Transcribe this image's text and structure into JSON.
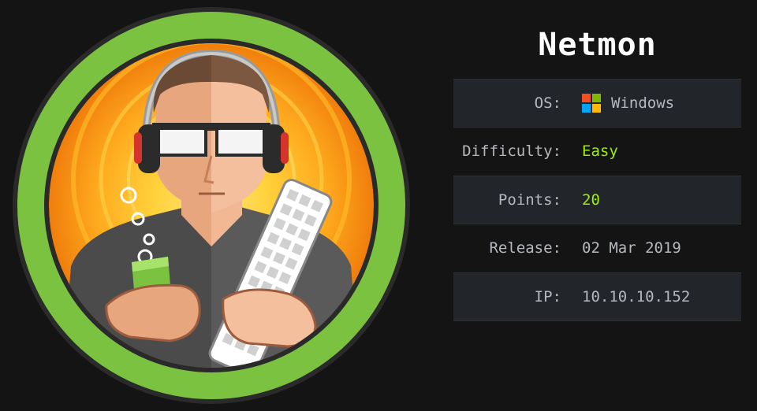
{
  "machine": {
    "name": "Netmon"
  },
  "info": {
    "os_label": "OS:",
    "os_value": "Windows",
    "os_icon": "windows-logo-icon",
    "difficulty_label": "Difficulty:",
    "difficulty_value": "Easy",
    "points_label": "Points:",
    "points_value": "20",
    "release_label": "Release:",
    "release_value": "02 Mar 2019",
    "ip_label": "IP:",
    "ip_value": "10.10.10.152"
  },
  "colors": {
    "background": "#141414",
    "accent_green": "#9fef00",
    "row_shade": "#22262b",
    "text_muted": "#b5b9bf",
    "ring_green": "#7cc241"
  }
}
